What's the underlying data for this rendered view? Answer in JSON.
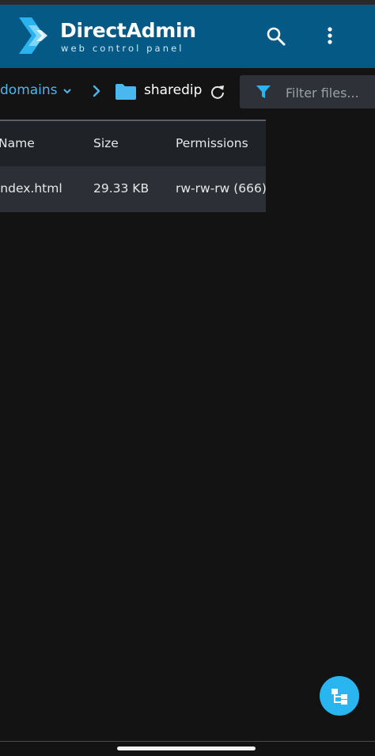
{
  "header": {
    "brand_name": "DirectAdmin",
    "brand_tagline": "web control panel",
    "bg_color": "#045a84",
    "icons": [
      "logo-icon",
      "search-icon",
      "more-vert-icon"
    ]
  },
  "pathbar": {
    "parent_crumb": "domains",
    "current_folder": "sharedip",
    "filter_placeholder": "Filter files...",
    "accent_color": "#4ab7ee"
  },
  "table": {
    "columns": [
      "Name",
      "Size",
      "Permissions"
    ],
    "rows": [
      {
        "name": "index.html",
        "size": "29.33 KB",
        "permissions": "rw-rw-rw (666)"
      }
    ]
  },
  "fab": {
    "icon": "sitemap-icon",
    "color": "#29b6f0"
  }
}
